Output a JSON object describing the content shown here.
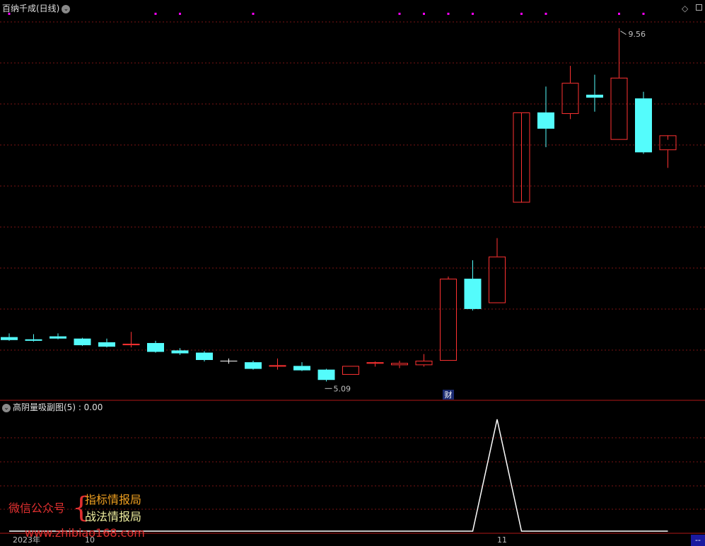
{
  "header": {
    "title": "百纳千成(日线)",
    "menu_icon": "chevron-down-icon",
    "diamond_icon": "diamond-icon",
    "square_icon": "square-icon"
  },
  "indicator_header": {
    "icon": "chevron-down-icon",
    "title": "高阴量吸副图(5) : 0.00"
  },
  "watermark": {
    "account_label": "微信公众号",
    "line1": "指标情报局",
    "line2": "战法情报局",
    "url": "www.zhibiao168.com"
  },
  "x_axis": {
    "year_label": "2023年",
    "month_label_1": "10",
    "month_label_2": "11",
    "end_box": "--"
  },
  "marker_label": "财",
  "colors": {
    "up": "#ff3232",
    "down": "#54fcfc",
    "flat": "#ffffff",
    "grid": "#7a1515",
    "divider": "#b01818",
    "dots": "#ff00ff"
  },
  "chart_data": [
    {
      "type": "candlestick",
      "name": "百纳千成(日线)",
      "annotations": {
        "high": {
          "label": "9.56",
          "value": 9.56,
          "index": 25
        },
        "low": {
          "label": "5.09",
          "value": 5.09,
          "index": 13
        },
        "marker": {
          "label": "财",
          "index": 18
        }
      },
      "ylim": [
        4.85,
        9.75
      ],
      "dot_markers_index": [
        0,
        6,
        7,
        10,
        16,
        17,
        18,
        19,
        21,
        22,
        25,
        26
      ],
      "candles": [
        {
          "open": 5.38,
          "high": 5.43,
          "low": 5.33,
          "close": 5.34
        },
        {
          "open": 5.35,
          "high": 5.42,
          "low": 5.32,
          "close": 5.33
        },
        {
          "open": 5.39,
          "high": 5.43,
          "low": 5.35,
          "close": 5.36
        },
        {
          "open": 5.36,
          "high": 5.37,
          "low": 5.26,
          "close": 5.27
        },
        {
          "open": 5.31,
          "high": 5.36,
          "low": 5.24,
          "close": 5.25
        },
        {
          "open": 5.27,
          "high": 5.45,
          "low": 5.24,
          "close": 5.29
        },
        {
          "open": 5.3,
          "high": 5.33,
          "low": 5.17,
          "close": 5.18
        },
        {
          "open": 5.2,
          "high": 5.23,
          "low": 5.14,
          "close": 5.16
        },
        {
          "open": 5.17,
          "high": 5.19,
          "low": 5.05,
          "close": 5.07
        },
        {
          "open": 5.06,
          "high": 5.09,
          "low": 5.02,
          "close": 5.06
        },
        {
          "open": 5.04,
          "high": 5.06,
          "low": 4.94,
          "close": 4.95
        },
        {
          "open": 4.98,
          "high": 5.09,
          "low": 4.94,
          "close": 5.0
        },
        {
          "open": 4.99,
          "high": 5.04,
          "low": 4.92,
          "close": 4.93
        },
        {
          "open": 4.94,
          "high": 4.95,
          "low": 4.78,
          "close": 4.8
        },
        {
          "open": 4.87,
          "high": 4.99,
          "low": 4.87,
          "close": 4.99
        },
        {
          "open": 5.02,
          "high": 5.05,
          "low": 4.98,
          "close": 5.04
        },
        {
          "open": 5.0,
          "high": 5.06,
          "low": 4.96,
          "close": 5.03
        },
        {
          "open": 5.0,
          "high": 5.15,
          "low": 4.98,
          "close": 5.06
        },
        {
          "open": 5.06,
          "high": 6.2,
          "low": 5.06,
          "close": 6.17
        },
        {
          "open": 6.17,
          "high": 6.42,
          "low": 5.74,
          "close": 5.76
        },
        {
          "open": 5.84,
          "high": 6.72,
          "low": 5.84,
          "close": 6.47
        },
        {
          "open": 7.2,
          "high": 7.2,
          "low": 7.2,
          "close": 8.42
        },
        {
          "open": 8.42,
          "high": 8.77,
          "low": 7.95,
          "close": 8.2
        },
        {
          "open": 8.4,
          "high": 9.05,
          "low": 8.33,
          "close": 8.82
        },
        {
          "open": 8.66,
          "high": 8.93,
          "low": 8.43,
          "close": 8.62
        },
        {
          "open": 8.05,
          "high": 9.56,
          "low": 8.05,
          "close": 8.89
        },
        {
          "open": 8.61,
          "high": 8.7,
          "low": 7.86,
          "close": 7.88
        },
        {
          "open": 7.91,
          "high": 8.05,
          "low": 7.67,
          "close": 8.11
        }
      ]
    },
    {
      "type": "line",
      "name": "高阴量吸副图(5)",
      "current_value": "0.00",
      "x_start_index": 0,
      "values": [
        0,
        0,
        0,
        0,
        0,
        0,
        0,
        0,
        0,
        0,
        0,
        0,
        0,
        0,
        0,
        0,
        0,
        0,
        0,
        0,
        1,
        0,
        0,
        0,
        0,
        0,
        0,
        0
      ],
      "ylim": [
        0,
        1.05
      ]
    }
  ]
}
